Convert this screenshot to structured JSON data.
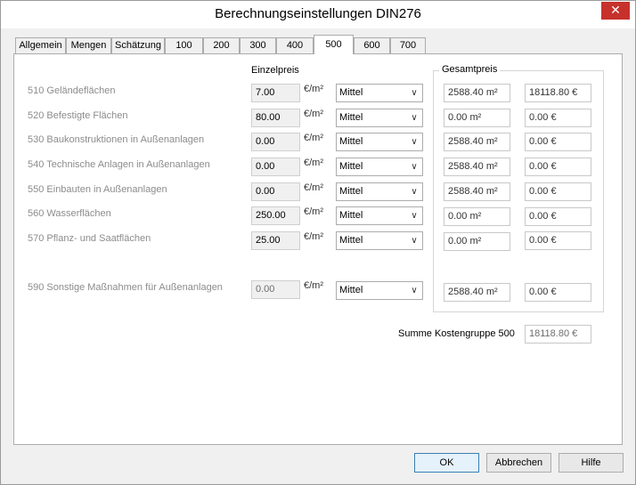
{
  "window": {
    "title": "Berechnungseinstellungen DIN276",
    "close_symbol": "✕"
  },
  "tabs": [
    "Allgemein",
    "Mengen",
    "Schätzung",
    "100",
    "200",
    "300",
    "400",
    "500",
    "600",
    "700"
  ],
  "active_tab": "500",
  "headers": {
    "unit_price": "Einzelpreis",
    "total_price": "Gesamtpreis"
  },
  "rows": [
    {
      "label": "510 Geländeflächen",
      "price": "7.00",
      "unit": "€/m²",
      "option": "Mittel",
      "area": "2588.40 m²",
      "cost": "18118.80 €"
    },
    {
      "label": "520 Befestigte Flächen",
      "price": "80.00",
      "unit": "€/m²",
      "option": "Mittel",
      "area": "0.00 m²",
      "cost": "0.00 €"
    },
    {
      "label": "530 Baukonstruktionen in Außenanlagen",
      "price": "0.00",
      "unit": "€/m²",
      "option": "Mittel",
      "area": "2588.40 m²",
      "cost": "0.00 €"
    },
    {
      "label": "540 Technische Anlagen in Außenanlagen",
      "price": "0.00",
      "unit": "€/m²",
      "option": "Mittel",
      "area": "2588.40 m²",
      "cost": "0.00 €"
    },
    {
      "label": "550 Einbauten in Außenanlagen",
      "price": "0.00",
      "unit": "€/m²",
      "option": "Mittel",
      "area": "2588.40 m²",
      "cost": "0.00 €"
    },
    {
      "label": "560 Wasserflächen",
      "price": "250.00",
      "unit": "€/m²",
      "option": "Mittel",
      "area": "0.00 m²",
      "cost": "0.00 €"
    },
    {
      "label": "570 Pflanz- und Saatflächen",
      "price": "25.00",
      "unit": "€/m²",
      "option": "Mittel",
      "area": "0.00 m²",
      "cost": "0.00 €"
    },
    {
      "label": "590 Sonstige Maßnahmen für Außenanlagen",
      "price": "0.00",
      "unit": "€/m²",
      "option": "Mittel",
      "area": "2588.40 m²",
      "cost": "0.00 €"
    }
  ],
  "summary": {
    "label": "Summe Kostengruppe 500",
    "value": "18118.80 €"
  },
  "buttons": {
    "ok": "OK",
    "cancel": "Abbrechen",
    "help": "Hilfe"
  }
}
